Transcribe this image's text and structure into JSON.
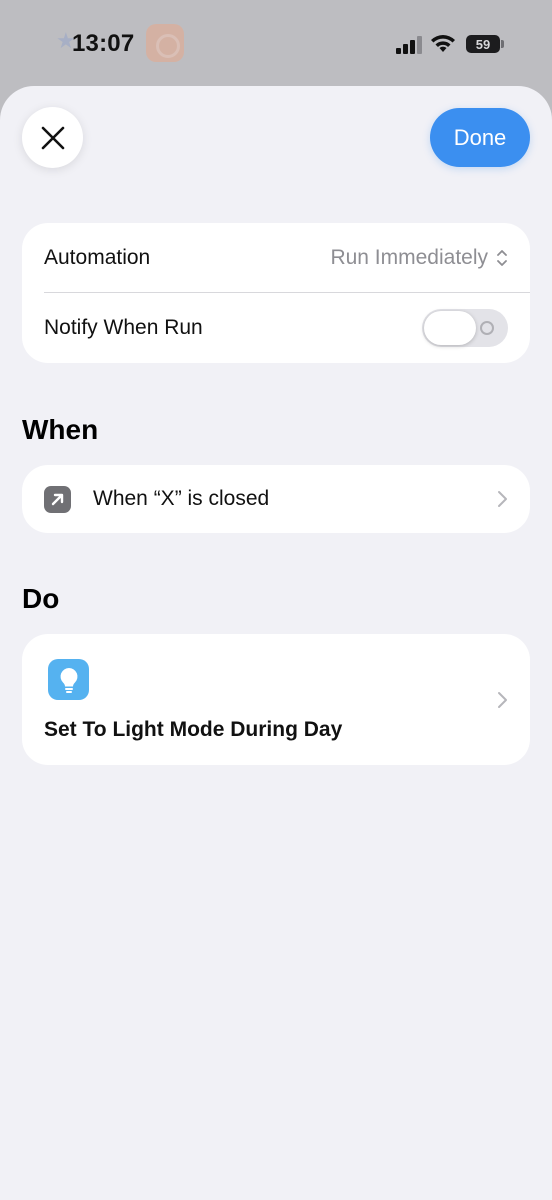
{
  "status_bar": {
    "time": "13:07",
    "battery_level": "59",
    "icons": [
      "cellular-signal-icon",
      "wifi-icon",
      "battery-icon"
    ]
  },
  "header": {
    "close_icon": "close-icon",
    "done_label": "Done"
  },
  "settings": {
    "automation_label": "Automation",
    "automation_value": "Run Immediately",
    "notify_label": "Notify When Run",
    "notify_enabled": false
  },
  "when_section": {
    "title": "When",
    "trigger_label": "When “X” is closed",
    "trigger_icon": "arrow-up-right-icon"
  },
  "do_section": {
    "title": "Do",
    "action_label": "Set To Light Mode During Day",
    "action_icon": "lightbulb-icon"
  },
  "colors": {
    "accent": "#3b8ff0",
    "sheet_background": "#f1f1f6",
    "card_background": "#ffffff",
    "secondary_text": "#8e8e93",
    "bulb_icon_bg": "#55b2f0"
  }
}
